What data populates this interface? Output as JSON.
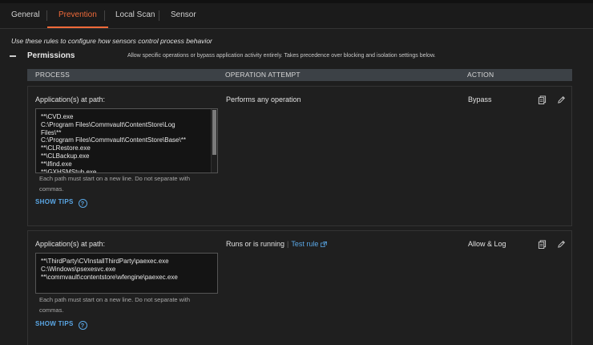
{
  "tabs": [
    {
      "label": "General",
      "active": false
    },
    {
      "label": "Prevention",
      "active": true
    },
    {
      "label": "Local Scan",
      "active": false
    },
    {
      "label": "Sensor",
      "active": false
    }
  ],
  "intro": "Use these rules to configure how sensors control process behavior",
  "section": {
    "title": "Permissions",
    "description": "Allow specific operations or bypass application activity entirely. Takes precedence over blocking and isolation settings below."
  },
  "table_headers": [
    "PROCESS",
    "OPERATION ATTEMPT",
    "ACTION"
  ],
  "rules": [
    {
      "label": "Application(s) at path:",
      "paths": "**\\CVD.exe\nC:\\Program Files\\Commvault\\ContentStore\\Log\nFiles\\**\nC:\\Program Files\\Commvault\\ContentStore\\Base\\**\n**\\CLRestore.exe\n**\\CLBackup.exe\n**\\Ifind.exe\n**\\GXHSMStub.exe",
      "help": "Each path must start on a new line. Do not separate with commas.",
      "tips_label": "SHOW TIPS",
      "operation": "Performs any operation",
      "test_rule": "",
      "action": "Bypass"
    },
    {
      "label": "Application(s) at path:",
      "paths": "**\\ThirdParty\\CVInstallThirdParty\\paexec.exe\nC:\\Windows\\psexesvc.exe\n**\\commvault\\contentstore\\wfengine\\paexec.exe",
      "help": "Each path must start on a new line. Do not separate with commas.",
      "tips_label": "SHOW TIPS",
      "operation": "Runs or is running",
      "test_rule": "Test rule",
      "action": "Allow & Log"
    }
  ],
  "colors": {
    "accent": "#ef6a3a",
    "link": "#5aa7e6",
    "header_bg": "#3c4146"
  }
}
